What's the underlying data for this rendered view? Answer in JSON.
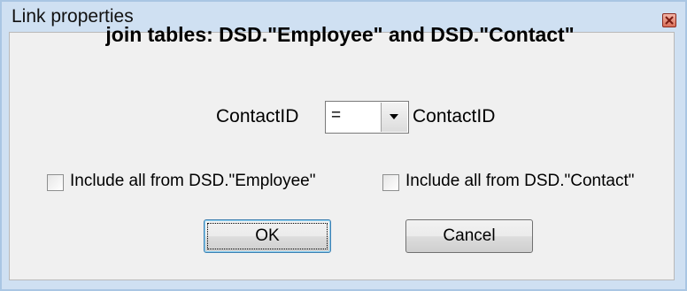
{
  "window": {
    "title": "Link properties"
  },
  "heading": "join tables: DSD.\"Employee\" and DSD.\"Contact\"",
  "join": {
    "left_field": "ContactID",
    "operator": "=",
    "right_field": "ContactID"
  },
  "options": {
    "include_left_label": "Include all from DSD.\"Employee\"",
    "include_left_checked": false,
    "include_right_label": "Include all from DSD.\"Contact\"",
    "include_right_checked": false
  },
  "buttons": {
    "ok_label": "OK",
    "cancel_label": "Cancel"
  },
  "icons": {
    "close": "close-icon",
    "dropdown": "chevron-down-icon"
  }
}
